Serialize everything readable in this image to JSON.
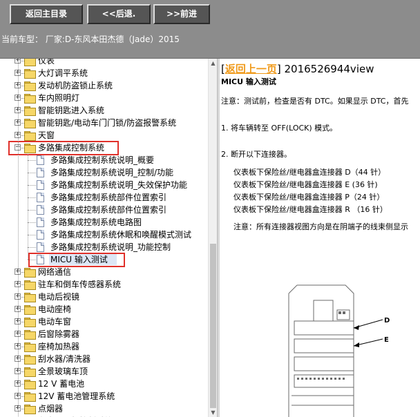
{
  "toolbar": {
    "home_label": "返回主目录",
    "back_label": "<<后退.",
    "forward_label": ">>前进"
  },
  "model_bar": {
    "text": "当前车型： 厂家:D-东风本田杰德（Jade）2015"
  },
  "tree": {
    "items": [
      {
        "label": "仪表",
        "level": 1,
        "type": "folder",
        "expanded": false
      },
      {
        "label": "大灯调平系统",
        "level": 1,
        "type": "folder",
        "expanded": false
      },
      {
        "label": "发动机防盗锁止系统",
        "level": 1,
        "type": "folder",
        "expanded": false
      },
      {
        "label": "车内照明灯",
        "level": 1,
        "type": "folder",
        "expanded": false
      },
      {
        "label": "智能钥匙进入系统",
        "level": 1,
        "type": "folder",
        "expanded": false
      },
      {
        "label": "智能钥匙/电动车门门锁/防盗报警系统",
        "level": 1,
        "type": "folder",
        "expanded": false
      },
      {
        "label": "天窗",
        "level": 1,
        "type": "folder",
        "expanded": false
      },
      {
        "label": "多路集成控制系统",
        "level": 1,
        "type": "folder",
        "expanded": true,
        "highlighted": true
      },
      {
        "label": "多路集成控制系统说明_概要",
        "level": 2,
        "type": "doc"
      },
      {
        "label": "多路集成控制系统说明_控制/功能",
        "level": 2,
        "type": "doc"
      },
      {
        "label": "多路集成控制系统说明_失效保护功能",
        "level": 2,
        "type": "doc"
      },
      {
        "label": "多路集成控制系统部件位置索引",
        "level": 2,
        "type": "doc"
      },
      {
        "label": "多路集成控制系统部件位置索引",
        "level": 2,
        "type": "doc"
      },
      {
        "label": "多路集成控制系统电路图",
        "level": 2,
        "type": "doc"
      },
      {
        "label": "多路集成控制系统休眠和唤醒模式测试",
        "level": 2,
        "type": "doc"
      },
      {
        "label": "多路集成控制系统说明_功能控制",
        "level": 2,
        "type": "doc"
      },
      {
        "label": "MICU 输入测试",
        "level": 2,
        "type": "doc",
        "selected": true,
        "highlighted": true
      },
      {
        "label": "网络通信",
        "level": 1,
        "type": "folder",
        "expanded": false
      },
      {
        "label": "驻车和倒车传感器系统",
        "level": 1,
        "type": "folder",
        "expanded": false
      },
      {
        "label": "电动后视镜",
        "level": 1,
        "type": "folder",
        "expanded": false
      },
      {
        "label": "电动座椅",
        "level": 1,
        "type": "folder",
        "expanded": false
      },
      {
        "label": "电动车窗",
        "level": 1,
        "type": "folder",
        "expanded": false
      },
      {
        "label": "后窗除雾器",
        "level": 1,
        "type": "folder",
        "expanded": false
      },
      {
        "label": "座椅加热器",
        "level": 1,
        "type": "folder",
        "expanded": false
      },
      {
        "label": "刮水器/清洗器",
        "level": 1,
        "type": "folder",
        "expanded": false
      },
      {
        "label": "全景玻璃车顶",
        "level": 1,
        "type": "folder",
        "expanded": false
      },
      {
        "label": "12 V 蓄电池",
        "level": 1,
        "type": "folder",
        "expanded": false
      },
      {
        "label": "12V 蓄电池管理系统",
        "level": 1,
        "type": "folder",
        "expanded": false
      },
      {
        "label": "点烟器",
        "level": 1,
        "type": "folder",
        "expanded": false
      },
      {
        "label": "车内照明灯控制系统",
        "level": 1,
        "type": "folder",
        "expanded": false
      }
    ]
  },
  "content": {
    "bracket_open": "[",
    "back_link": "返回上一页",
    "bracket_close": "]",
    "doc_id": " 2016526944view",
    "heading": "MICU 输入测试",
    "note_intro": "注意：测试前，检查是否有 DTC。如果显示 DTC，首先",
    "step1": "1.   将车辆转至 OFF(LOCK) 模式。",
    "step2": "2.   断开以下连接器。",
    "connectors": [
      "仪表板下保险丝/继电器盒连接器 D（44 针）",
      "仪表板下保险丝/继电器盒连接器 E (36 针)",
      "仪表板下保险丝/继电器盒连接器 P（24 针）",
      "仪表板下保险丝/继电器盒连接器 R （16 针）"
    ],
    "note_connector": "注意：所有连接器视图方向是在阴端子的线束侧显示",
    "diagram_labels": {
      "d": "D",
      "e": "E"
    }
  },
  "colors": {
    "toolbar_bg": "#8c8c8c",
    "button_bg": "#555555",
    "link": "#f09a1a",
    "highlight_box": "#e0302a",
    "selection_bg": "#dce6f5"
  }
}
